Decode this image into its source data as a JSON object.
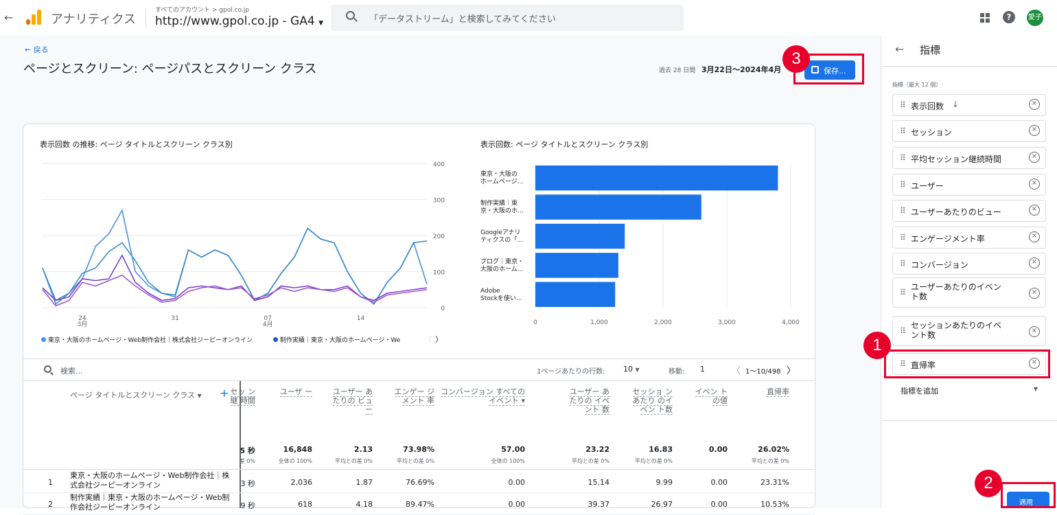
{
  "topbar": {
    "app_title": "アナリティクス",
    "account_breadcrumb": "すべてのアカウント > gpol.co.jp",
    "property_name": "http://www.gpol.co.jp - GA4",
    "search_placeholder": "「データストリーム」と検索してみてください",
    "avatar_text": "愛子"
  },
  "page": {
    "back_label": "← 戻る",
    "title": "ページとスクリーン: ページパスとスクリーン クラス",
    "date_prefix": "過去 28 日間",
    "date_range": "3月22日～2024年4月1",
    "save_label": "保存..."
  },
  "line_chart": {
    "title": "表示回数 の推移: ページ タイトルとスクリーン クラス別",
    "y_ticks": [
      "400",
      "300",
      "200",
      "100",
      "0"
    ],
    "x_ticks": [
      {
        "day": "24",
        "month": "3月"
      },
      {
        "day": "31",
        "month": ""
      },
      {
        "day": "07",
        "month": "4月"
      },
      {
        "day": "14",
        "month": ""
      }
    ],
    "legend": [
      "東京・大阪のホームページ・Web制作会社｜株式会社ジーピーオンライン",
      "制作実績｜東京・大阪のホームページ・We"
    ]
  },
  "bar_chart": {
    "title": "表示回数: ページ タイトルとスクリーン クラス別",
    "x_ticks": [
      "0",
      "1,000",
      "2,000",
      "3,000",
      "4,000"
    ]
  },
  "chart_data": [
    {
      "type": "line",
      "title": "表示回数 の推移: ページ タイトルとスクリーン クラス別",
      "xlabel": "",
      "ylabel": "",
      "ylim": [
        0,
        400
      ],
      "x": [
        "3/21",
        "3/22",
        "3/23",
        "3/24",
        "3/25",
        "3/26",
        "3/27",
        "3/28",
        "3/29",
        "3/30",
        "3/31",
        "4/1",
        "4/2",
        "4/3",
        "4/4",
        "4/5",
        "4/6",
        "4/7",
        "4/8",
        "4/9",
        "4/10",
        "4/11",
        "4/12",
        "4/13",
        "4/14",
        "4/15",
        "4/16",
        "4/17",
        "4/18",
        "4/19"
      ],
      "series": [
        {
          "color": "#4a90e2",
          "values": [
            110,
            10,
            40,
            80,
            170,
            205,
            270,
            100,
            60,
            40,
            30,
            160,
            140,
            160,
            145,
            90,
            20,
            40,
            95,
            140,
            220,
            190,
            180,
            100,
            40,
            10,
            70,
            110,
            180,
            65
          ]
        },
        {
          "color": "#3c8bc4",
          "values": [
            110,
            20,
            40,
            95,
            110,
            155,
            180,
            130,
            70,
            40,
            35,
            160,
            140,
            160,
            145,
            90,
            20,
            40,
            95,
            140,
            220,
            190,
            180,
            100,
            40,
            10,
            70,
            110,
            180,
            185
          ]
        },
        {
          "color": "#7b3fc4",
          "values": [
            55,
            20,
            30,
            80,
            75,
            80,
            145,
            70,
            40,
            20,
            25,
            55,
            60,
            55,
            50,
            60,
            20,
            30,
            60,
            55,
            60,
            50,
            50,
            60,
            30,
            20,
            40,
            45,
            50,
            55
          ]
        },
        {
          "color": "#9b59d0",
          "values": [
            50,
            5,
            20,
            70,
            60,
            75,
            90,
            60,
            35,
            15,
            20,
            45,
            55,
            60,
            50,
            55,
            25,
            35,
            55,
            45,
            55,
            50,
            45,
            55,
            30,
            15,
            35,
            40,
            45,
            50
          ]
        }
      ]
    },
    {
      "type": "bar",
      "title": "表示回数: ページ タイトルとスクリーン クラス別",
      "categories": [
        "東京・大阪の ホームページ...",
        "制作実績｜東 京・大阪のホ...",
        "Googleアナリ ティクスの「...",
        "ブログ｜東京・ 大阪のホーム...",
        "Adobe Stockを使い..."
      ],
      "values": [
        3800,
        2600,
        1400,
        1300,
        1250
      ],
      "xlim": [
        0,
        4000
      ]
    }
  ],
  "table": {
    "search_placeholder": "検索...",
    "rows_per_page_label": "1ページあたりの行数:",
    "rows_per_page": "10",
    "goto_label": "移動:",
    "goto_value": "1",
    "pagination": "1〜10/498",
    "dimension_header": "ページ タイトルとスクリーン クラス",
    "columns": [
      {
        "label": "セッ ン継 時間",
        "total": "5 秒",
        "sub": "差 0%"
      },
      {
        "label": "ユーザ ー",
        "total": "16,848",
        "sub": "全体の 100%"
      },
      {
        "label": "ユーザー あたりの ビュー",
        "total": "2.13",
        "sub": "平均との差 0%"
      },
      {
        "label": "エンゲー ジメント 率",
        "total": "73.98%",
        "sub": "平均との差 0%"
      },
      {
        "label": "コンバージョン すべてのイベント ▾",
        "total": "57.00",
        "sub": "全体の 100%"
      },
      {
        "label": "ユーザー あたりの イベント 数",
        "total": "23.22",
        "sub": "平均との差 0%"
      },
      {
        "label": "セッショ ンあたり のイベン ト数",
        "total": "16.83",
        "sub": "平均との差 0%"
      },
      {
        "label": "イベン トの値",
        "total": "0.00",
        "sub": ""
      },
      {
        "label": "直帰率",
        "total": "26.02%",
        "sub": "平均との差 0%"
      }
    ],
    "rows": [
      {
        "idx": "1",
        "title": "東京・大阪のホームページ・Web制作会社｜株式会社ジーピーオンライン",
        "cells": [
          "3 秒",
          "2,036",
          "1.87",
          "76.69%",
          "0.00",
          "15.14",
          "9.99",
          "0.00",
          "23.31%"
        ]
      },
      {
        "idx": "2",
        "title": "制作実績｜東京・大阪のホームページ・Web制作会社ジーピーオンライン",
        "cells": [
          "9 秒",
          "618",
          "4.18",
          "89.47%",
          "0.00",
          "39.37",
          "26.97",
          "0.00",
          "10.53%"
        ]
      }
    ]
  },
  "panel": {
    "title": "指標",
    "section_label": "指標（最大 12 個）",
    "metrics": [
      "表示回数",
      "セッション",
      "平均セッション継続時間",
      "ユーザー",
      "ユーザーあたりのビュー",
      "エンゲージメント率",
      "コンバージョン",
      "ユーザーあたりのイベント数",
      "セッションあたりのイベント数",
      "直帰率"
    ],
    "add_metric_label": "指標を追加",
    "apply_label": "適用"
  },
  "annotations": [
    "1",
    "2",
    "3"
  ]
}
